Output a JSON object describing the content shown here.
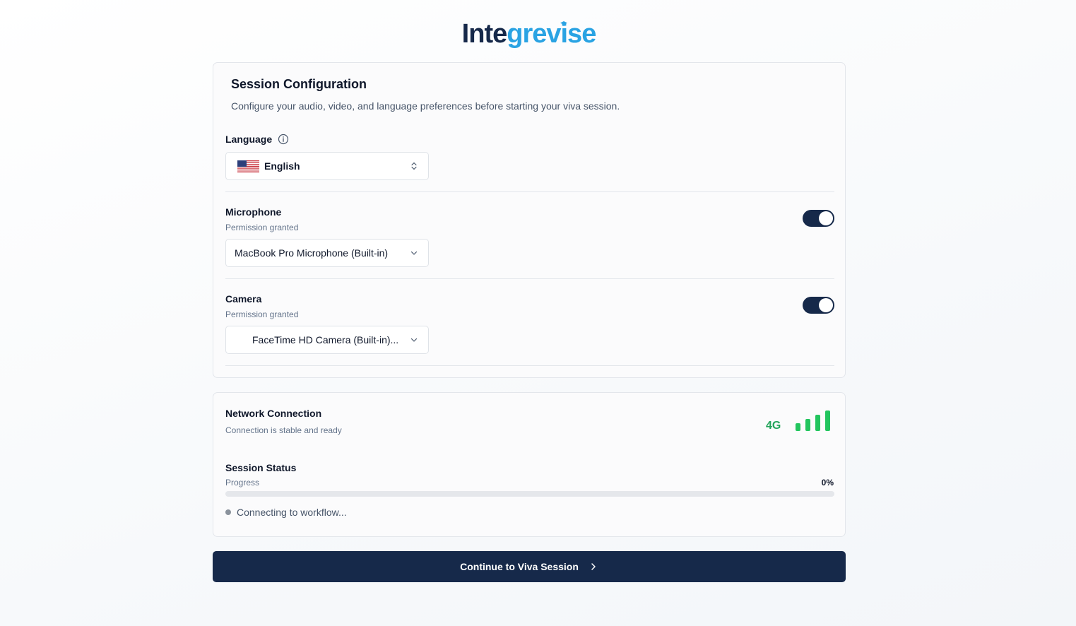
{
  "brand": {
    "logo_part1": "Inte",
    "logo_part2": "grevise"
  },
  "config": {
    "title": "Session Configuration",
    "subtitle": "Configure your audio, video, and language preferences before starting your viva session.",
    "language": {
      "label": "Language",
      "selected": "English",
      "flag": "us-flag-icon"
    },
    "microphone": {
      "label": "Microphone",
      "permission": "Permission granted",
      "enabled": true,
      "device": "MacBook Pro Microphone (Built-in)"
    },
    "camera": {
      "label": "Camera",
      "permission": "Permission granted",
      "enabled": true,
      "device": "FaceTime HD Camera (Built-in)..."
    }
  },
  "network": {
    "label": "Network Connection",
    "status": "Connection is stable and ready",
    "type": "4G",
    "signal_bars": 4,
    "signal_color": "#22c55e"
  },
  "session_status": {
    "label": "Session Status",
    "progress_label": "Progress",
    "progress_text": "0%",
    "progress_value": 0,
    "message": "Connecting to workflow..."
  },
  "cta": {
    "label": "Continue to Viva Session"
  },
  "colors": {
    "primary": "#16294a",
    "accent": "#2aa3e3",
    "success": "#22a45a"
  }
}
